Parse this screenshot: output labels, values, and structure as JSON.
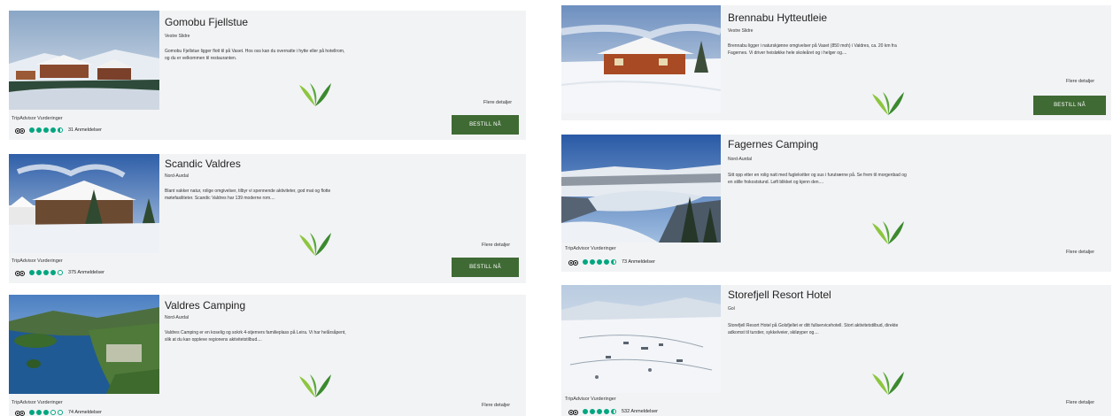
{
  "cards": [
    {
      "title": "Gomobu Fjellstue",
      "location": "Vestre Slidre",
      "desc": "Gomobu Fjellstue ligger flott til på Vaset. Hos oss kan du overnatte i hytte eller på hotellrom, og du er velkommen til restauranten.",
      "more": "Flere detaljer",
      "book": "BESTILL NÅ",
      "ta_label": "TripAdvisor Vurderinger",
      "rating": 4.5,
      "reviews": "31 Anmeldelser"
    },
    {
      "title": "Scandic Valdres",
      "location": "Nord-Aurdal",
      "desc": "Blant vakker natur, rolige omgivelser, tilbyr vi spennende aktiviteter, god mat og flotte møtefasiliteter. Scandic Valdres har 139 moderne rom....",
      "more": "Flere detaljer",
      "book": "BESTILL NÅ",
      "ta_label": "TripAdvisor Vurderinger",
      "rating": 4,
      "reviews": "375 Anmeldelser"
    },
    {
      "title": "Valdres Camping",
      "location": "Nord-Aurdal",
      "desc": "Valdres Camping er en koselig og sokrk 4-stjerners familieplass på Leira. Vi har helårsåpent, slik at du kan oppleve regionens aktivitetstilbud....",
      "more": "Flere detaljer",
      "ta_label": "TripAdvisor Vurderinger",
      "rating": 3,
      "reviews": "74 Anmeldelser"
    },
    {
      "title": "Brennabu Hytteutleie",
      "location": "Vestre Slidre",
      "desc": "Brennabu ligger i naturskjønne omgivelser på Vaset (850 moh) i Valdres, ca. 20 km fra Fagernes. Vi driver heisløkke hele skoleåret og i helger og....",
      "more": "Flere detaljer",
      "book": "BESTILL NÅ"
    },
    {
      "title": "Fagernes Camping",
      "location": "Nord-Aurdal",
      "desc": "Sitt opp etter en rolig natt med fuglekvitter og sus i furutrærne på. Se frem til morgenbad og en stille frokoststund. Løft blikket og kjenn den....",
      "more": "Flere detaljer",
      "ta_label": "TripAdvisor Vurderinger",
      "rating": 4.5,
      "reviews": "73 Anmeldelser"
    },
    {
      "title": "Storefjell Resort Hotel",
      "location": "Gol",
      "desc": "Storefjell Resort Hotel på Golsfjellet er ditt fullservicehotell. Stort aktivitetstilbud, direkte adkomst til turstier, sykkelveier, skiløyper og....",
      "more": "Flere detaljer",
      "ta_label": "TripAdvisor Vurderinger",
      "rating": 4.5,
      "reviews": "532 Anmeldelser"
    }
  ],
  "icons": {
    "leaf": "leaf-logo-icon",
    "tripadvisor": "tripadvisor-owl-icon"
  },
  "colors": {
    "book_button": "#3f6a34",
    "leaf_light": "#8cc63f",
    "leaf_dark": "#3b8a2e",
    "ta_green": "#00a680",
    "card_bg": "#f2f3f5"
  }
}
